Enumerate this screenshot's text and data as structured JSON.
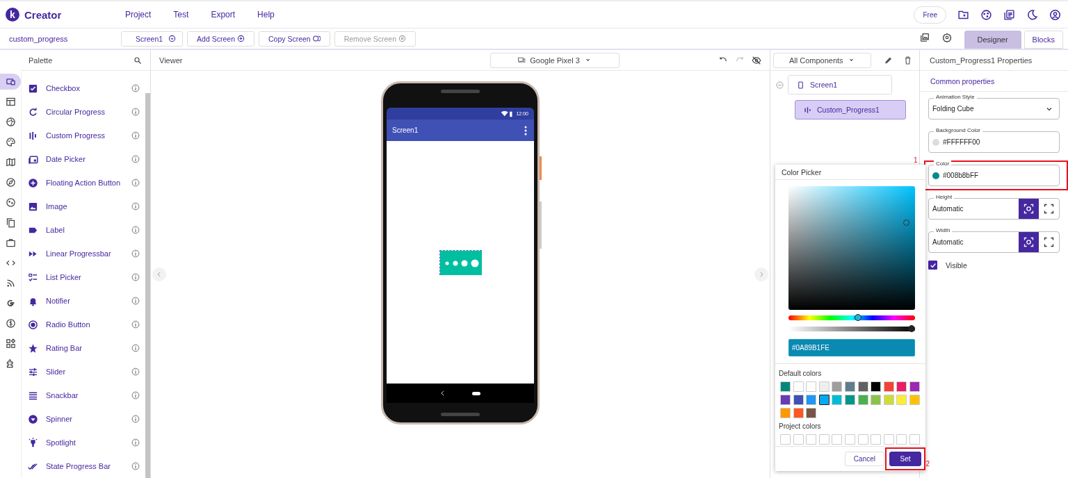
{
  "app": {
    "logo_letter": "k",
    "name": "Creator"
  },
  "menu": [
    "Project",
    "Test",
    "Export",
    "Help"
  ],
  "plan_badge": "Free",
  "project_name": "custom_progress",
  "screen_buttons": [
    {
      "label": "Screen1",
      "kind": "dropdown",
      "disabled": false
    },
    {
      "label": "Add Screen",
      "kind": "add",
      "disabled": false
    },
    {
      "label": "Copy Screen",
      "kind": "copy",
      "disabled": false
    },
    {
      "label": "Remove Screen",
      "kind": "remove",
      "disabled": true
    }
  ],
  "mode_tabs": [
    {
      "label": "Designer",
      "selected": true
    },
    {
      "label": "Blocks",
      "selected": false
    }
  ],
  "palette": {
    "title": "Palette",
    "categories": [
      {
        "selected": true
      },
      {
        "selected": false
      },
      {
        "selected": false
      },
      {
        "selected": false
      },
      {
        "selected": false
      },
      {
        "selected": false
      },
      {
        "selected": false
      },
      {
        "selected": false
      },
      {
        "selected": false
      },
      {
        "selected": false
      },
      {
        "selected": false
      },
      {
        "selected": false
      },
      {
        "selected": false
      },
      {
        "selected": false
      },
      {
        "selected": false
      }
    ],
    "items": [
      "Checkbox",
      "Circular Progress",
      "Custom Progress",
      "Date Picker",
      "Floating Action Button",
      "Image",
      "Label",
      "Linear Progressbar",
      "List Picker",
      "Notifier",
      "Radio Button",
      "Rating Bar",
      "Slider",
      "Snackbar",
      "Spinner",
      "Spotlight",
      "State Progress Bar"
    ]
  },
  "viewer": {
    "title": "Viewer",
    "device": "Google Pixel 3",
    "phone": {
      "time": "12:00",
      "screen_title": "Screen1"
    }
  },
  "components": {
    "filter": "All Components",
    "tree": [
      {
        "name": "Screen1",
        "selected": false,
        "children": [
          {
            "name": "Custom_Progress1",
            "selected": true
          }
        ]
      }
    ]
  },
  "properties": {
    "title": "Custom_Progress1 Properties",
    "section": "Common properties",
    "fields": [
      {
        "kind": "select",
        "label": "Animation Style",
        "value": "Folding Cube"
      },
      {
        "kind": "color",
        "label": "Background Color",
        "value": "#FFFFFF00",
        "color": "#dddddd",
        "highlighted": false
      },
      {
        "kind": "color",
        "label": "Color",
        "value": "#008b8bFF",
        "color": "#008b8b",
        "highlighted": true,
        "callout": "1"
      },
      {
        "kind": "size",
        "label": "Height",
        "value": "Automatic"
      },
      {
        "kind": "size",
        "label": "Width",
        "value": "Automatic"
      },
      {
        "kind": "checkbox",
        "label": "Visible",
        "checked": true
      }
    ]
  },
  "color_picker": {
    "title": "Color Picker",
    "hue": {
      "level": 0.55
    },
    "alpha": {
      "level": 1
    },
    "hex": "#0A89B1FE",
    "default_title": "Default colors",
    "default_colors": [
      {
        "color": "#00897b",
        "selected": false
      },
      {
        "color": "#ffffff",
        "selected": false
      },
      {
        "color": "#ffffff",
        "selected": false
      },
      {
        "color": "#eeeeee",
        "selected": false
      },
      {
        "color": "#9e9e9e",
        "selected": false
      },
      {
        "color": "#607d8b",
        "selected": false
      },
      {
        "color": "#616161",
        "selected": false
      },
      {
        "color": "#000000",
        "selected": false
      },
      {
        "color": "#f44336",
        "selected": false
      },
      {
        "color": "#e91e63",
        "selected": false
      },
      {
        "color": "#9c27b0",
        "selected": false
      },
      {
        "color": "#673ab7",
        "selected": false
      },
      {
        "color": "#3f51b5",
        "selected": false
      },
      {
        "color": "#2196f3",
        "selected": false
      },
      {
        "color": "#03a9f4",
        "selected": true
      },
      {
        "color": "#00bcd4",
        "selected": false
      },
      {
        "color": "#009688",
        "selected": false
      },
      {
        "color": "#4caf50",
        "selected": false
      },
      {
        "color": "#8bc34a",
        "selected": false
      },
      {
        "color": "#cddc39",
        "selected": false
      },
      {
        "color": "#ffeb3b",
        "selected": false
      },
      {
        "color": "#ffc107",
        "selected": false
      },
      {
        "color": "#ff9800",
        "selected": false
      },
      {
        "color": "#ff5722",
        "selected": false
      },
      {
        "color": "#795548",
        "selected": false
      }
    ],
    "project_title": "Project colors",
    "buttons": [
      {
        "label": "Cancel",
        "kind": "secondary",
        "highlighted": false
      },
      {
        "label": "Set",
        "kind": "primary",
        "highlighted": true,
        "callout": "2"
      }
    ]
  }
}
